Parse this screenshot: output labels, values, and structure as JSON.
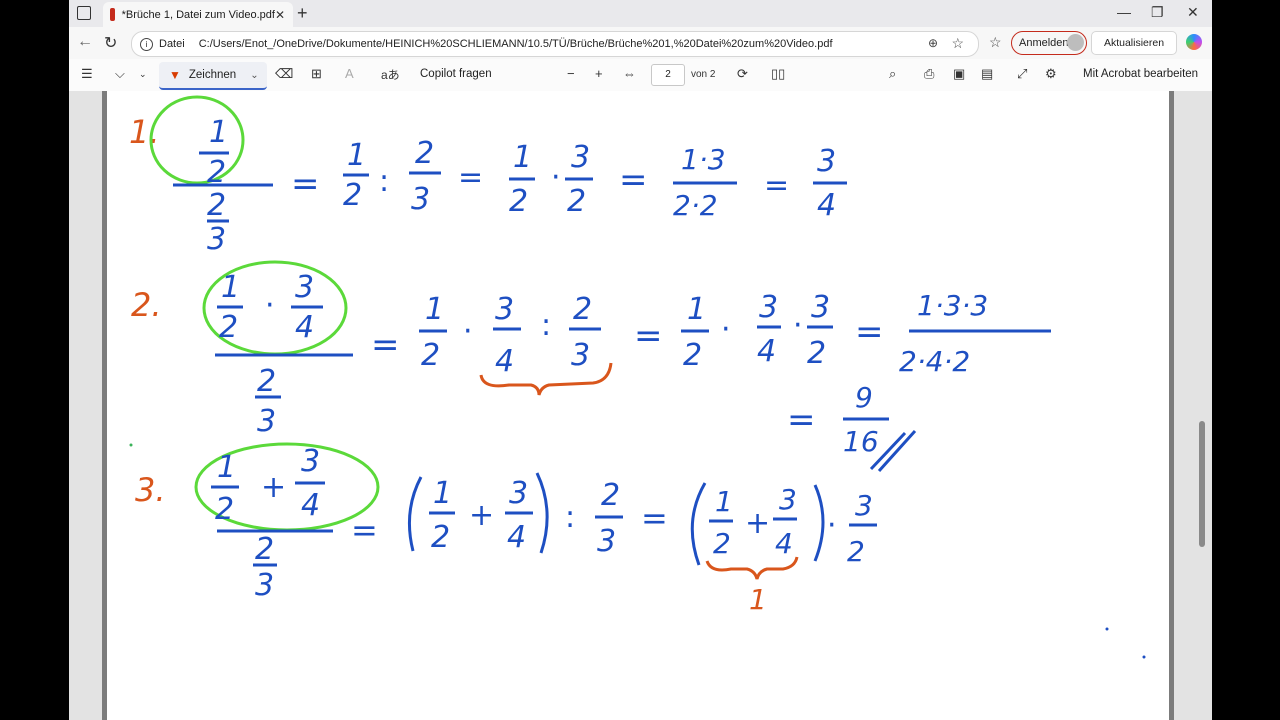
{
  "browser": {
    "tab_title": "*Brüche 1, Datei zum Video.pdf",
    "address_label": "Datei",
    "url": "C:/Users/Enot_/OneDrive/Dokumente/HEINICH%20SCHLIEMANN/10.5/TÜ/Brüche/Brüche%201,%20Datei%20zum%20Video.pdf",
    "signin_label": "Anmelden",
    "update_label": "Aktualisieren"
  },
  "pdf_toolbar": {
    "draw_label": "Zeichnen",
    "copilot_label": "Copilot fragen",
    "page_current": "2",
    "page_total_label": "von 2",
    "acrobat_label": "Mit Acrobat bearbeiten"
  },
  "colors": {
    "ink_blue": "#1e4fc2",
    "ink_orange": "#d9561c",
    "ink_green": "#5bd93a",
    "accent_red": "#c42b1c"
  },
  "worksheet": {
    "problems": [
      {
        "number": "1."
      },
      {
        "number": "2."
      },
      {
        "number": "3."
      }
    ],
    "result_note": "1"
  }
}
